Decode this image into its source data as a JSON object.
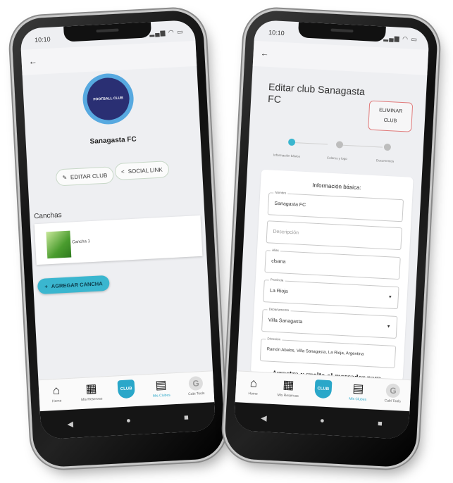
{
  "left_phone": {
    "status_time": "10:10",
    "back_icon": "arrow-left-icon",
    "club_logo_text": "FOOTBALL CLUB",
    "club_name": "Sanagasta FC",
    "edit_button": "EDITAR CLUB",
    "social_button": "SOCIAL LINK",
    "section_title": "Canchas",
    "court_label": "Cancha 1",
    "add_button": "AGREGAR CANCHA"
  },
  "right_phone": {
    "status_time": "10:10",
    "back_icon": "arrow-left-icon",
    "title": "Editar club Sanagasta FC",
    "delete_button_line1": "ELIMINAR",
    "delete_button_line2": "CLUB",
    "steps": [
      "Información básica",
      "Colores y logo",
      "Documentos"
    ],
    "form_title": "Información básica:",
    "fields": {
      "nombre_label": "Nombre",
      "nombre_value": "Sanagasta FC",
      "descripcion_placeholder": "Descripción",
      "alias_label": "Alias",
      "alias_value": "clsana",
      "provincia_label": "Provincia",
      "provincia_value": "La Rioja",
      "departamento_label": "Departamento",
      "departamento_value": "Villa Sanagasta",
      "direccion_label": "Dirección",
      "direccion_value": "Ramón Abalos, Villa Sanagasta, La Rioja, Argentina"
    },
    "drag_text": "Arrastra y suelta el marcador para presisar la"
  },
  "bottom_nav": [
    {
      "label": "Home",
      "icon": "home-icon"
    },
    {
      "label": "Mis Reservas",
      "icon": "calendar-icon"
    },
    {
      "label": "",
      "icon": "club-logo-icon",
      "badge_text": "CLUB"
    },
    {
      "label": "Mis Clubes",
      "icon": "dashboard-icon"
    },
    {
      "label": "Cabi Tools",
      "icon": "avatar-icon",
      "avatar_letter": "G"
    }
  ],
  "colors": {
    "accent": "#3ab6cf",
    "danger_border": "#e07a7a",
    "logo_ring": "#57a9e0",
    "logo_fill": "#2a2f73"
  }
}
